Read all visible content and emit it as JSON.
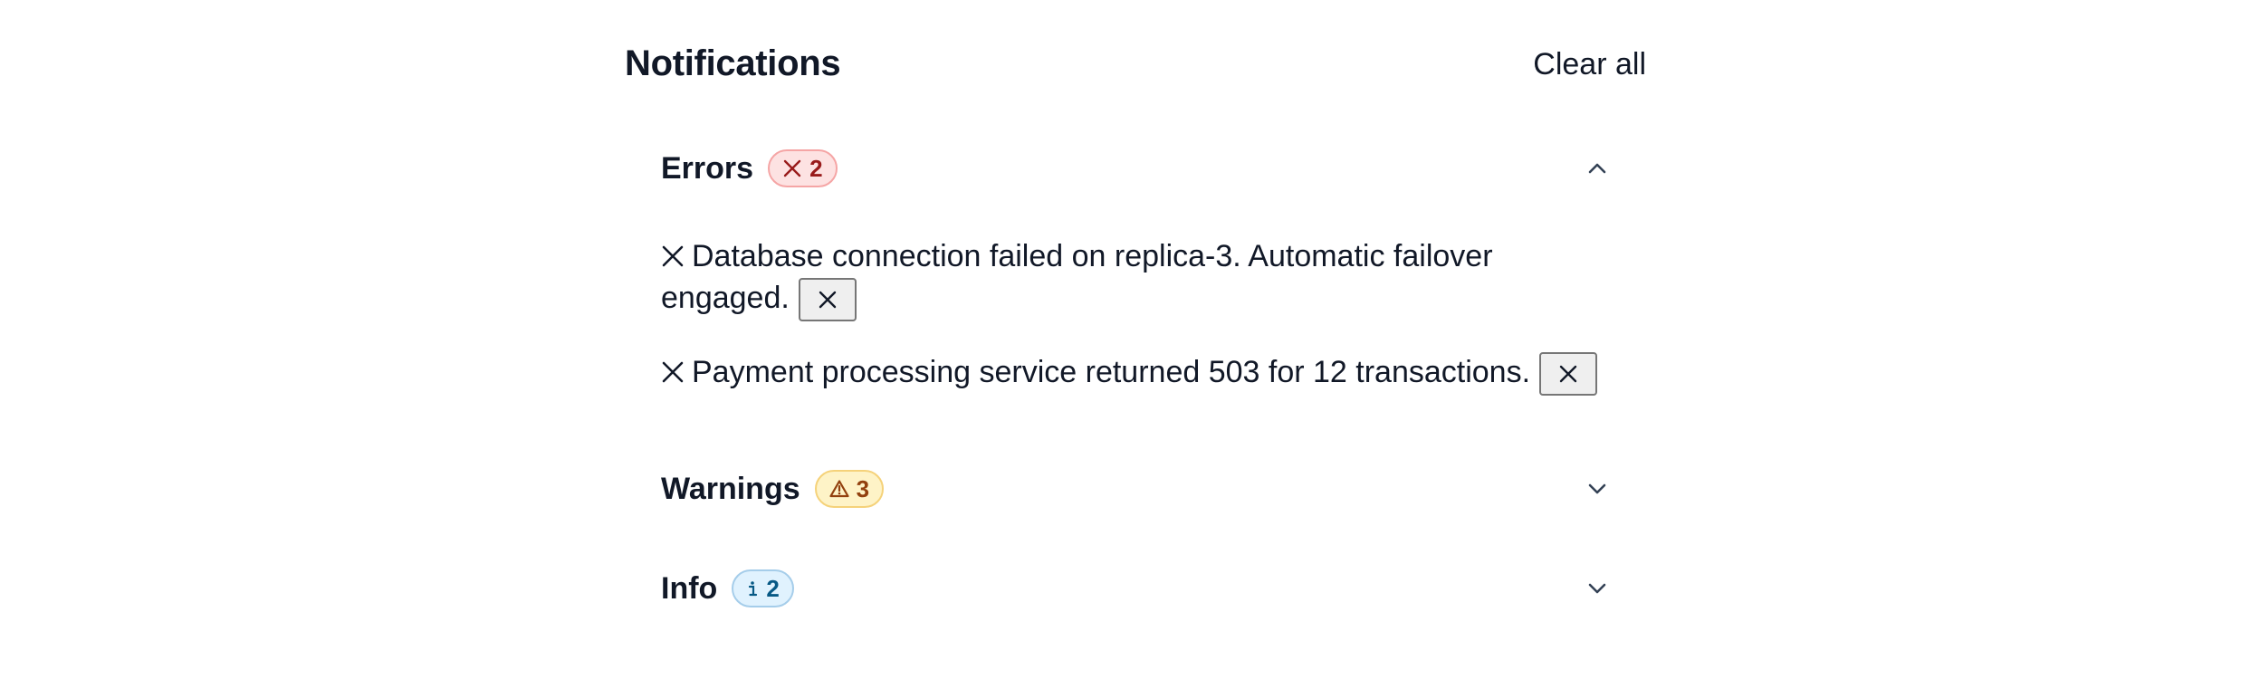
{
  "header": {
    "title": "Notifications",
    "clear_all_label": "Clear all"
  },
  "sections": [
    {
      "label": "Errors",
      "count": "2",
      "badge_icon": "✕",
      "icon_name": "x-icon",
      "expanded": true,
      "chevron": "chevron-up-icon",
      "accent": "#991b1b",
      "messages": [
        {
          "text": "Database connection failed on replica-3. Automatic failover engaged."
        },
        {
          "text": "Payment processing service returned 503 for 12 transactions."
        }
      ]
    },
    {
      "label": "Warnings",
      "count": "3",
      "badge_icon": "⚠",
      "icon_name": "warning-icon",
      "expanded": false,
      "chevron": "chevron-down-icon",
      "accent": "#92400e"
    },
    {
      "label": "Info",
      "count": "2",
      "badge_icon": "ℹ",
      "icon_name": "info-icon",
      "expanded": false,
      "chevron": "chevron-down-icon",
      "accent": "#075985"
    }
  ]
}
